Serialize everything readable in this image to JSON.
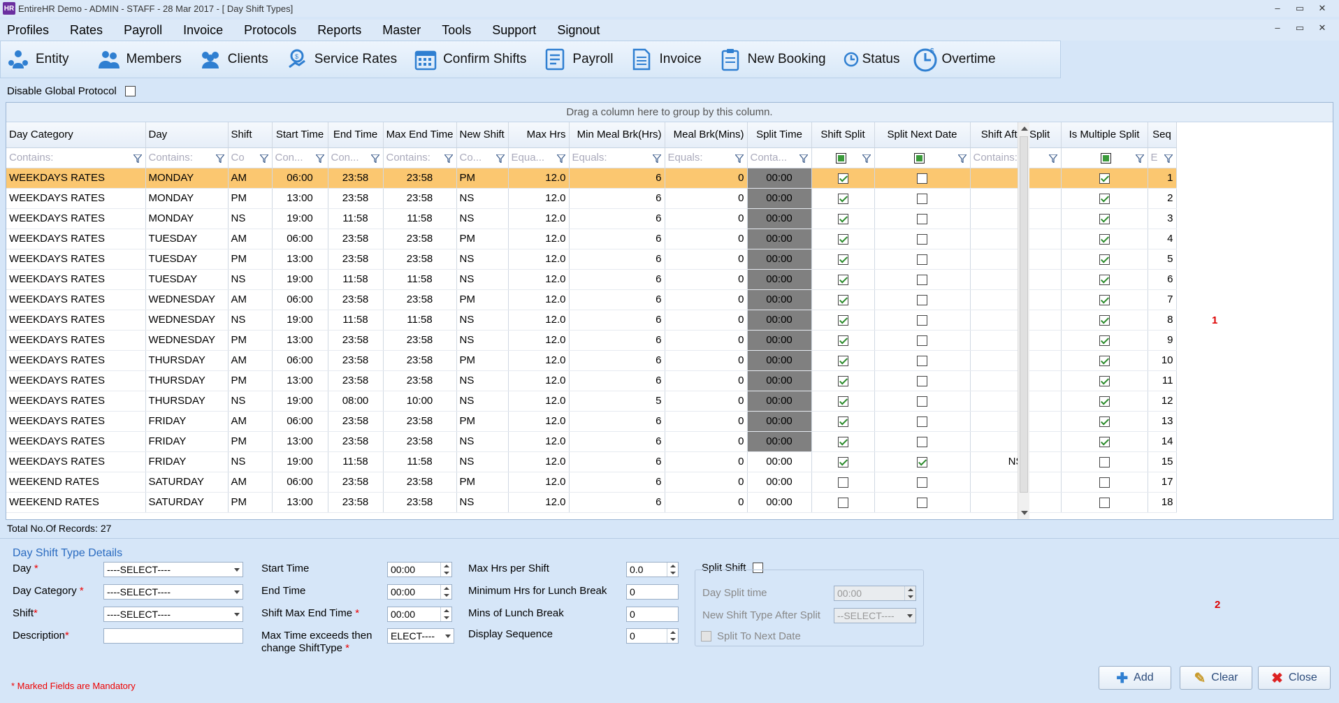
{
  "window": {
    "title": "EntireHR Demo - ADMIN - STAFF - 28 Mar 2017 - [  Day Shift Types]",
    "controls": [
      "–",
      "▭",
      "✕"
    ]
  },
  "menu": [
    "Profiles",
    "Rates",
    "Payroll",
    "Invoice",
    "Protocols",
    "Reports",
    "Master",
    "Tools",
    "Support",
    "Signout"
  ],
  "toolbar": [
    {
      "label": "Entity",
      "icon": "entity-icon"
    },
    {
      "label": "Members",
      "icon": "members-icon"
    },
    {
      "label": "Clients",
      "icon": "clients-icon"
    },
    {
      "label": "Service Rates",
      "icon": "service-rates-icon"
    },
    {
      "label": "Confirm Shifts",
      "icon": "calendar-icon"
    },
    {
      "label": "Payroll",
      "icon": "payroll-icon"
    },
    {
      "label": "Invoice",
      "icon": "invoice-icon"
    },
    {
      "label": "New Booking",
      "icon": "clipboard-icon"
    },
    {
      "label": "Status",
      "icon": "clock-icon"
    },
    {
      "label": "Overtime",
      "icon": "overtime-icon"
    }
  ],
  "protocol": {
    "label": "Disable Global Protocol",
    "checked": false
  },
  "grid": {
    "group_hint": "Drag a column here to group by this column.",
    "columns": [
      "Day Category",
      "Day",
      "Shift",
      "Start Time",
      "End Time",
      "Max End Time",
      "New Shift",
      "Max Hrs",
      "Min Meal Brk(Hrs)",
      "Meal Brk(Mins)",
      "Split Time",
      "Shift Split",
      "Split Next Date",
      "Shift After Split",
      "Is Multiple Split",
      "Seq"
    ],
    "filters": [
      "Contains:",
      "Contains:",
      "Co",
      "Con...",
      "Con...",
      "Contains:",
      "Co...",
      "Equa...",
      "Equals:",
      "Equals:",
      "Conta...",
      "",
      "",
      "Contains:",
      "",
      "E"
    ],
    "rows": [
      [
        "WEEKDAYS RATES",
        "MONDAY",
        "AM",
        "06:00",
        "23:58",
        "23:58",
        "PM",
        "12.0",
        "6",
        "0",
        "00:00",
        true,
        false,
        "",
        true,
        "1"
      ],
      [
        "WEEKDAYS RATES",
        "MONDAY",
        "PM",
        "13:00",
        "23:58",
        "23:58",
        "NS",
        "12.0",
        "6",
        "0",
        "00:00",
        true,
        false,
        "",
        true,
        "2"
      ],
      [
        "WEEKDAYS RATES",
        "MONDAY",
        "NS",
        "19:00",
        "11:58",
        "11:58",
        "NS",
        "12.0",
        "6",
        "0",
        "00:00",
        true,
        false,
        "",
        true,
        "3"
      ],
      [
        "WEEKDAYS RATES",
        "TUESDAY",
        "AM",
        "06:00",
        "23:58",
        "23:58",
        "PM",
        "12.0",
        "6",
        "0",
        "00:00",
        true,
        false,
        "",
        true,
        "4"
      ],
      [
        "WEEKDAYS RATES",
        "TUESDAY",
        "PM",
        "13:00",
        "23:58",
        "23:58",
        "NS",
        "12.0",
        "6",
        "0",
        "00:00",
        true,
        false,
        "",
        true,
        "5"
      ],
      [
        "WEEKDAYS RATES",
        "TUESDAY",
        "NS",
        "19:00",
        "11:58",
        "11:58",
        "NS",
        "12.0",
        "6",
        "0",
        "00:00",
        true,
        false,
        "",
        true,
        "6"
      ],
      [
        "WEEKDAYS RATES",
        "WEDNESDAY",
        "AM",
        "06:00",
        "23:58",
        "23:58",
        "PM",
        "12.0",
        "6",
        "0",
        "00:00",
        true,
        false,
        "",
        true,
        "7"
      ],
      [
        "WEEKDAYS RATES",
        "WEDNESDAY",
        "NS",
        "19:00",
        "11:58",
        "11:58",
        "NS",
        "12.0",
        "6",
        "0",
        "00:00",
        true,
        false,
        "",
        true,
        "8"
      ],
      [
        "WEEKDAYS RATES",
        "WEDNESDAY",
        "PM",
        "13:00",
        "23:58",
        "23:58",
        "NS",
        "12.0",
        "6",
        "0",
        "00:00",
        true,
        false,
        "",
        true,
        "9"
      ],
      [
        "WEEKDAYS RATES",
        "THURSDAY",
        "AM",
        "06:00",
        "23:58",
        "23:58",
        "PM",
        "12.0",
        "6",
        "0",
        "00:00",
        true,
        false,
        "",
        true,
        "10"
      ],
      [
        "WEEKDAYS RATES",
        "THURSDAY",
        "PM",
        "13:00",
        "23:58",
        "23:58",
        "NS",
        "12.0",
        "6",
        "0",
        "00:00",
        true,
        false,
        "",
        true,
        "11"
      ],
      [
        "WEEKDAYS RATES",
        "THURSDAY",
        "NS",
        "19:00",
        "08:00",
        "10:00",
        "NS",
        "12.0",
        "5",
        "0",
        "00:00",
        true,
        false,
        "",
        true,
        "12"
      ],
      [
        "WEEKDAYS RATES",
        "FRIDAY",
        "AM",
        "06:00",
        "23:58",
        "23:58",
        "PM",
        "12.0",
        "6",
        "0",
        "00:00",
        true,
        false,
        "",
        true,
        "13"
      ],
      [
        "WEEKDAYS RATES",
        "FRIDAY",
        "PM",
        "13:00",
        "23:58",
        "23:58",
        "NS",
        "12.0",
        "6",
        "0",
        "00:00",
        true,
        false,
        "",
        true,
        "14"
      ],
      [
        "WEEKDAYS RATES",
        "FRIDAY",
        "NS",
        "19:00",
        "11:58",
        "11:58",
        "NS",
        "12.0",
        "6",
        "0",
        "00:00",
        true,
        true,
        "NS",
        false,
        "15"
      ],
      [
        "WEEKEND RATES",
        "SATURDAY",
        "AM",
        "06:00",
        "23:58",
        "23:58",
        "PM",
        "12.0",
        "6",
        "0",
        "00:00",
        false,
        false,
        "",
        false,
        "17"
      ],
      [
        "WEEKEND RATES",
        "SATURDAY",
        "PM",
        "13:00",
        "23:58",
        "23:58",
        "NS",
        "12.0",
        "6",
        "0",
        "00:00",
        false,
        false,
        "",
        false,
        "18"
      ]
    ],
    "selected_row": 0,
    "dark_split_rows": 14,
    "total": "Total No.Of Records: 27",
    "marker": "1"
  },
  "details": {
    "title": "Day Shift Type Details",
    "day_label": "Day",
    "day_value": "----SELECT----",
    "category_label": "Day Category",
    "category_value": "----SELECT----",
    "shift_label": "Shift",
    "shift_value": "----SELECT----",
    "description_label": "Description",
    "start_label": "Start Time",
    "start_value": "00:00",
    "end_label": "End Time",
    "end_value": "00:00",
    "maxend_label": "Shift Max End Time",
    "maxend_value": "00:00",
    "exceed_label_1": "Max Time exceeds then",
    "exceed_label_2": "change ShiftType",
    "exceed_value": "ELECT----",
    "maxhrs_label": "Max Hrs per Shift",
    "maxhrs_value": "0.0",
    "minhrs_label": "Minimum Hrs for Lunch Break",
    "minhrs_value": "0",
    "mins_label": "Mins of Lunch Break",
    "mins_value": "0",
    "seq_label": "Display Sequence",
    "seq_value": "0",
    "split_label": "Split Shift",
    "daysplit_label": "Day Split time",
    "daysplit_value": "00:00",
    "newshift_label": "New Shift Type After Split",
    "newshift_value": "--SELECT----",
    "nextdate_label": "Split To Next Date",
    "marker": "2",
    "mandatory": "* Marked Fields are Mandatory",
    "asterisk": "*",
    "add": "Add",
    "clear": "Clear",
    "close": "Close"
  }
}
